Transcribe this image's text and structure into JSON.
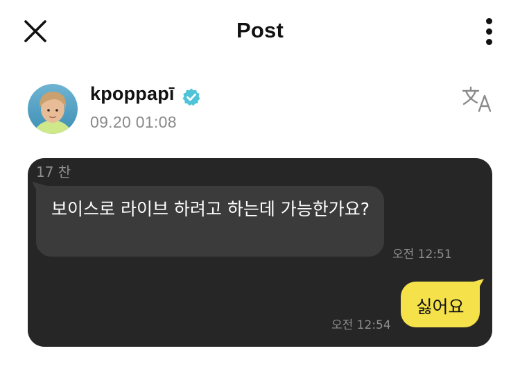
{
  "header": {
    "title": "Post",
    "close_icon": "close-icon",
    "more_icon": "more-vertical-icon"
  },
  "post": {
    "author": "kpoppapī",
    "verified": true,
    "verified_color": "#4fc3d8",
    "timestamp": "09.20 01:08",
    "translate_icon": "translate-icon"
  },
  "chat": {
    "background": "#262626",
    "header_text": "17 찬",
    "messages": [
      {
        "side": "received",
        "text": "보이스로 라이브 하려고 하는데 가능한가요?",
        "time": "오전 12:51",
        "bubble_color": "#3b3b3b"
      },
      {
        "side": "sent",
        "text": "싫어요",
        "time": "오전 12:54",
        "bubble_color": "#f5e14a"
      }
    ]
  }
}
